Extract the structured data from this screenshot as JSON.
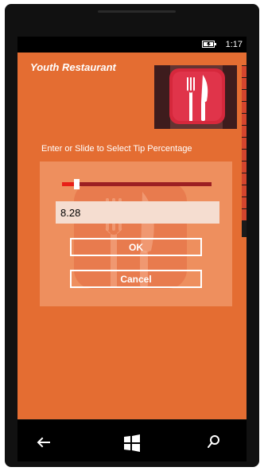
{
  "status_bar": {
    "time": "1:17",
    "battery_icon": "battery-charging-icon"
  },
  "app": {
    "title": "Youth  Restaurant",
    "prompt": "Enter or Slide to Select Tip Percentage",
    "hero_icon": "fork-knife-icon"
  },
  "dialog": {
    "slider": {
      "value_fraction": 0.1
    },
    "input_value": "8.28",
    "ok_label": "OK",
    "cancel_label": "Cancel"
  },
  "navigation": {
    "back_icon": "back-arrow-icon",
    "start_icon": "windows-start-icon",
    "search_icon": "search-icon"
  },
  "colors": {
    "page": "#e46d32",
    "dialog": "#ee8f5e",
    "slider_active": "#e81f17",
    "slider_track": "#9c1f22",
    "input_background": "#f5ddd0"
  }
}
